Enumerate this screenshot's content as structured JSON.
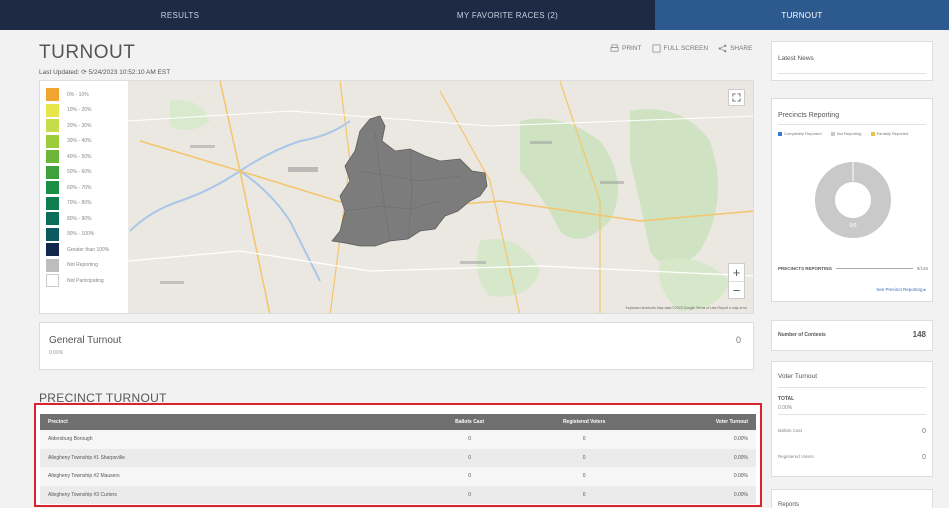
{
  "nav": {
    "tabs": [
      "RESULTS",
      "MY FAVORITE RACES (2)",
      "TURNOUT"
    ]
  },
  "header": {
    "title": "TURNOUT",
    "last_updated": "Last Updated: ⟳ 5/24/2023 10:52:10 AM EST",
    "print": "PRINT",
    "full_screen": "FULL SCREEN",
    "share": "SHARE"
  },
  "legend": {
    "items": [
      {
        "label": "0% - 10%",
        "color": "#f0a531"
      },
      {
        "label": "10% - 20%",
        "color": "#e6e64a"
      },
      {
        "label": "20% - 30%",
        "color": "#c6dc4a"
      },
      {
        "label": "30% - 40%",
        "color": "#9ccc3c"
      },
      {
        "label": "40% - 50%",
        "color": "#6cb63a"
      },
      {
        "label": "50% - 60%",
        "color": "#3ea23c"
      },
      {
        "label": "60% - 70%",
        "color": "#1b8f46"
      },
      {
        "label": "70% - 80%",
        "color": "#0f7f52"
      },
      {
        "label": "80% - 90%",
        "color": "#0b6e5a"
      },
      {
        "label": "90% - 100%",
        "color": "#0c5a5e"
      },
      {
        "label": "Greater than 100%",
        "color": "#13294b"
      },
      {
        "label": "Not Reporting",
        "color": "#bdbdbd"
      },
      {
        "label": "Not Participating",
        "color": "#ffffff"
      }
    ]
  },
  "map": {
    "attribution": "Keyboard shortcuts   Map data ©2023 Google   Terms of Use   Report a map error"
  },
  "general_turnout": {
    "title": "General Turnout",
    "percent": "0.00%",
    "count": "0"
  },
  "precinct_turnout": {
    "title": "PRECINCT TURNOUT",
    "columns": [
      "Precinct",
      "Ballots Cast",
      "Registered Voters",
      "Voter Turnout"
    ],
    "rows": [
      [
        "Aldersburg Borough",
        "0",
        "0",
        "0.00%"
      ],
      [
        "Allegheny Township #1 Sharpsville",
        "0",
        "0",
        "0.00%"
      ],
      [
        "Allegheny Township #2 Mausers",
        "0",
        "0",
        "0.00%"
      ],
      [
        "Allegheny Township #3 Curters",
        "0",
        "0",
        "0.00%"
      ]
    ]
  },
  "sidebar": {
    "latest_news": "Latest News",
    "precincts_reporting": {
      "title": "Precincts Reporting",
      "legend": [
        {
          "label": "Completely Reported",
          "color": "#3a78c9"
        },
        {
          "label": "Not Reporting",
          "color": "#c9c9c9"
        },
        {
          "label": "Partially Reported",
          "color": "#e6c24a"
        }
      ],
      "center_text": "0/0",
      "reporting_label": "PRECINCTS REPORTING",
      "reporting_value": "0/145",
      "link": "See Precinct Reporting ▸"
    },
    "number_of_contests": {
      "label": "Number of Contests",
      "value": "148"
    },
    "voter_turnout": {
      "title": "Voter Turnout",
      "total_label": "TOTAL",
      "total_value": "0.00%",
      "ballots_cast_label": "Ballots Cast",
      "ballots_cast_value": "0",
      "registered_label": "Registered Voters",
      "registered_value": "0"
    },
    "reports": "Reports"
  }
}
